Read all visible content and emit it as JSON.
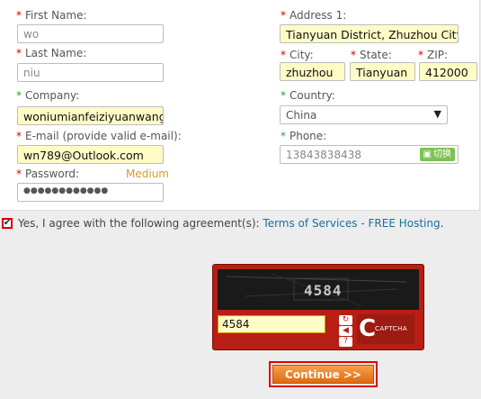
{
  "form": {
    "first_name": {
      "label": "First Name:",
      "value": "wo"
    },
    "last_name": {
      "label": "Last Name:",
      "value": "niu"
    },
    "company": {
      "label": "Company:",
      "value": "woniumianfeiziyuanwang"
    },
    "email": {
      "label": "E-mail (provide valid e-mail):",
      "value": "wn789@Outlook.com"
    },
    "password": {
      "label": "Password:",
      "value": "●●●●●●●●●●●●",
      "strength": "Medium"
    },
    "address1": {
      "label": "Address 1:",
      "value": "Tianyuan District, Zhuzhou City, Hu"
    },
    "city": {
      "label": "City:",
      "value": "zhuzhou"
    },
    "state": {
      "label": "State:",
      "value": "Tianyuan"
    },
    "zip": {
      "label": "ZIP:",
      "value": "412000"
    },
    "country": {
      "label": "Country:",
      "value": "China"
    },
    "phone": {
      "label": "Phone:",
      "value": "13843838438",
      "badge": "切换"
    },
    "required_mark": "*",
    "optional_mark": "*"
  },
  "agreement": {
    "checked": true,
    "text": "Yes, I agree with the following agreement(s):",
    "link": "Terms of Services - FREE Hosting",
    "end": "."
  },
  "captcha": {
    "image_text": "4584",
    "input_value": "4584",
    "brand": "CAPTCHA",
    "refresh_icon": "↻",
    "audio_icon": "◀",
    "help_icon": "?"
  },
  "continue": {
    "label": "Continue >>"
  },
  "colors": {
    "required": "#cc0000",
    "optional": "#339933",
    "accent": "#b81e13",
    "button": "#e06a10"
  }
}
